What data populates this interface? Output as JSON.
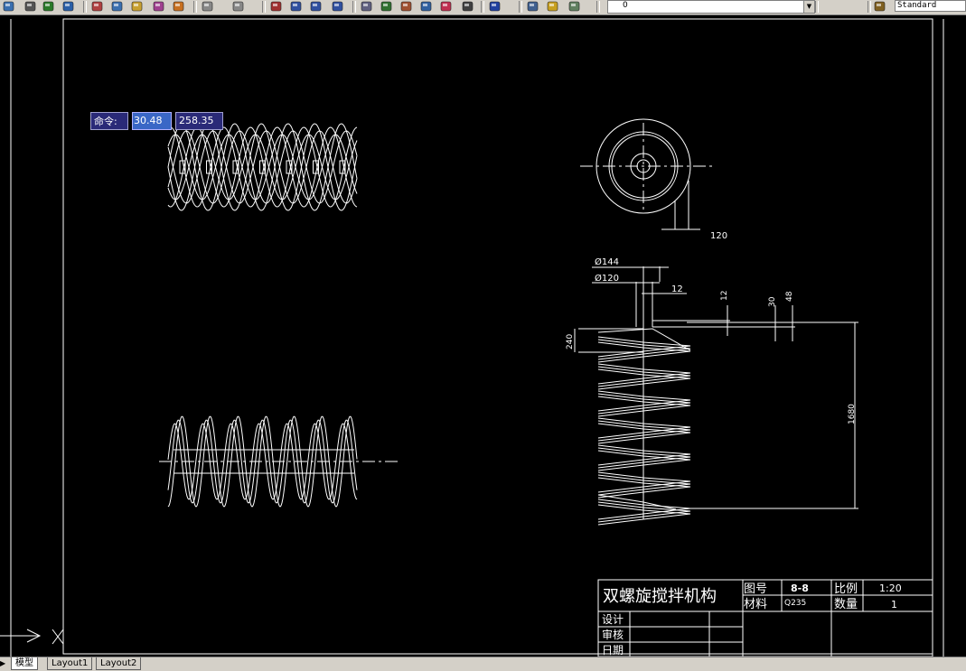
{
  "toolbar": {
    "icons": [
      "save-icon",
      "print-icon",
      "plot-preview-icon",
      "publish-icon",
      "cut-icon",
      "copy-icon",
      "paste-icon",
      "match-properties-icon",
      "block-editor-icon",
      "undo-icon",
      "redo-icon",
      "pan-icon",
      "zoom-realtime-icon",
      "zoom-window-icon",
      "zoom-previous-icon",
      "properties-icon",
      "design-center-icon",
      "tool-palettes-icon",
      "sheet-set-icon",
      "markup-icon",
      "quickcalc-icon",
      "help-icon",
      "layer-manager-icon",
      "layer-state-icon",
      "layer-previous-icon",
      "text-style-icon"
    ],
    "layer_value": "0",
    "text_style": "Standard"
  },
  "dynamic_input": {
    "label": "命令:",
    "x_value": "30.48",
    "y_value": "258.35"
  },
  "drawing": {
    "dimensions": {
      "d120_top": "120",
      "dia144": "Ø144",
      "dia120": "Ø120",
      "d12_side": "12",
      "d12_vert": "12",
      "d30": "30",
      "d48": "48",
      "d240": "240",
      "d1680": "1680"
    },
    "title_block": {
      "title": "双螺旋搅拌机构",
      "drawing_no_label": "图号",
      "drawing_no": "8-8",
      "scale_label": "比例",
      "scale": "1:20",
      "material_label": "材料",
      "material": "Q235",
      "quantity_label": "数量",
      "quantity": "1",
      "design_label": "设计",
      "review_label": "审核",
      "date_label": "日期"
    }
  },
  "tabs": [
    {
      "label": "模型",
      "active": true
    },
    {
      "label": "Layout1",
      "active": false
    },
    {
      "label": "Layout2",
      "active": false
    }
  ]
}
